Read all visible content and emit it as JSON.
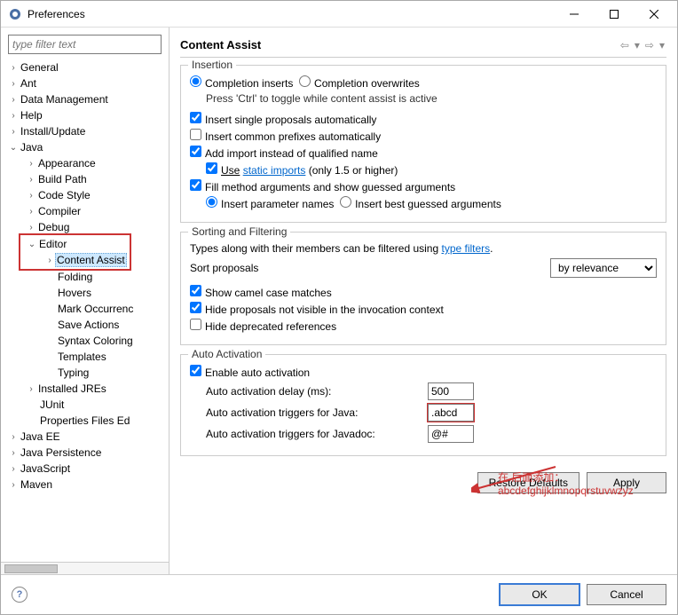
{
  "window": {
    "title": "Preferences"
  },
  "filter": {
    "placeholder": "type filter text"
  },
  "tree": {
    "general": "General",
    "ant": "Ant",
    "data_mgmt": "Data Management",
    "help": "Help",
    "install": "Install/Update",
    "java": "Java",
    "appearance": "Appearance",
    "build_path": "Build Path",
    "code_style": "Code Style",
    "compiler": "Compiler",
    "debug": "Debug",
    "editor": "Editor",
    "content_assist": "Content Assist",
    "folding": "Folding",
    "hovers": "Hovers",
    "mark_occ": "Mark Occurrenc",
    "save_actions": "Save Actions",
    "syntax": "Syntax Coloring",
    "templates": "Templates",
    "typing": "Typing",
    "installed_jres": "Installed JREs",
    "junit": "JUnit",
    "prop_files": "Properties Files Ed",
    "java_ee": "Java EE",
    "java_persistence": "Java Persistence",
    "javascript": "JavaScript",
    "maven": "Maven"
  },
  "page": {
    "title": "Content Assist",
    "insertion": {
      "legend": "Insertion",
      "comp_inserts": "Completion inserts",
      "comp_overwrites": "Completion overwrites",
      "ctrl_hint": "Press 'Ctrl' to toggle while content assist is active",
      "single_prop": "Insert single proposals automatically",
      "common_prefix": "Insert common prefixes automatically",
      "add_import": "Add import instead of qualified name",
      "use": "Use",
      "static_imports": "static imports",
      "only15": " (only 1.5 or higher)",
      "fill_method": "Fill method arguments and show guessed arguments",
      "insert_param": "Insert parameter names",
      "insert_best": "Insert best guessed arguments"
    },
    "sorting": {
      "legend": "Sorting and Filtering",
      "types_text": "Types along with their members can be filtered using ",
      "type_filters": "type filters",
      "sort_label": "Sort proposals",
      "sort_value": "by relevance",
      "camel": "Show camel case matches",
      "hide_inv": "Hide proposals not visible in the invocation context",
      "hide_dep": "Hide deprecated references"
    },
    "auto": {
      "legend": "Auto Activation",
      "enable": "Enable auto activation",
      "delay_label": "Auto activation delay (ms):",
      "delay_value": "500",
      "java_label": "Auto activation triggers for Java:",
      "java_value": ".abcd",
      "jdoc_label": "Auto activation triggers for Javadoc:",
      "jdoc_value": "@#"
    },
    "buttons": {
      "restore": "Restore Defaults",
      "apply": "Apply",
      "ok": "OK",
      "cancel": "Cancel"
    }
  },
  "annotation": {
    "line1": "在.后面添加：",
    "line2": "abcdefghijklmnopqrstuvwzyz"
  }
}
